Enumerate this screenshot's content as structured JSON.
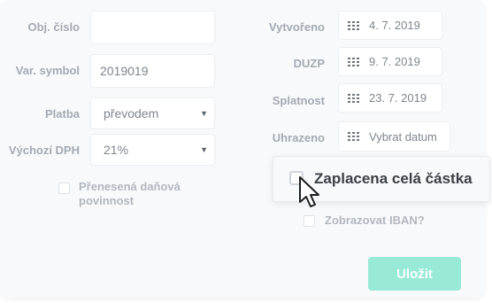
{
  "form": {
    "obj_cislo": {
      "label": "Obj. číslo",
      "value": ""
    },
    "var_symbol": {
      "label": "Var. symbol",
      "value": "2019019"
    },
    "platba": {
      "label": "Platba",
      "value": "převodem"
    },
    "vychozi_dph": {
      "label": "Výchozí DPH",
      "value": "21%"
    },
    "prenesena": {
      "label": "Přenesená daňová povinnost",
      "checked": false
    }
  },
  "dates": {
    "vytvoreno": {
      "label": "Vytvořeno",
      "value": "4. 7. 2019"
    },
    "duzp": {
      "label": "DUZP",
      "value": "9. 7. 2019"
    },
    "splatnost": {
      "label": "Splatnost",
      "value": "23. 7. 2019"
    },
    "uhrazeno": {
      "label": "Uhrazeno",
      "placeholder": "Vybrat datum"
    }
  },
  "popup": {
    "label": "Zaplacena celá částka",
    "checked": false
  },
  "iban": {
    "label": "Zobrazovat IBAN?",
    "checked": false
  },
  "save_label": "Uložit",
  "colors": {
    "accent": "#98ead7",
    "label": "#a3aab3",
    "text": "#7f868f",
    "background": "#f8f9fb"
  },
  "icons": {
    "calendar": "calendar-icon",
    "chevron": "chevron-down-icon",
    "cursor": "mouse-cursor-icon"
  }
}
